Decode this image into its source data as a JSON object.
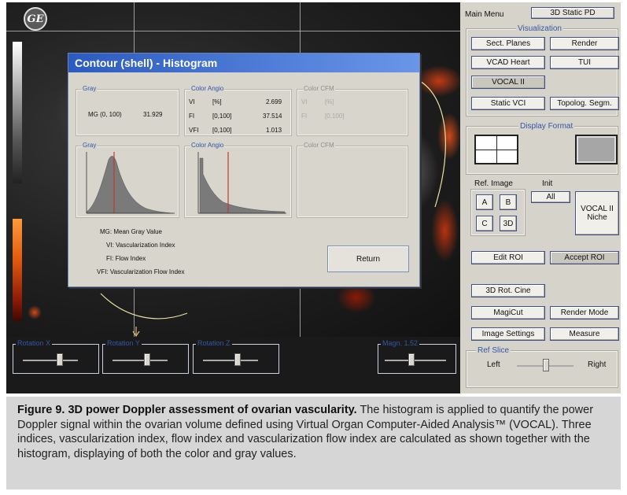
{
  "app": {
    "logo_text": "GE"
  },
  "dialog": {
    "title": "Contour (shell) - Histogram",
    "gray_group": {
      "label": "Gray",
      "mg_label": "MG (0, 100)",
      "mg_value": "31.929"
    },
    "color_angio_group": {
      "label": "Color Angio",
      "rows": [
        {
          "name": "VI",
          "range": "[%]",
          "value": "2.699"
        },
        {
          "name": "FI",
          "range": "[0,100]",
          "value": "37.514"
        },
        {
          "name": "VFI",
          "range": "[0,100]",
          "value": "1.013"
        }
      ]
    },
    "color_cfm_group": {
      "label": "Color CFM",
      "rows": [
        {
          "name": "VI",
          "range": "[%]"
        },
        {
          "name": "FI",
          "range": "[0,100]"
        }
      ]
    },
    "hist_gray_label": "Gray",
    "hist_angio_label": "Color Angio",
    "hist_cfm_label": "Color CFM",
    "legend": [
      {
        "abbr": "MG",
        "text": "Mean Gray Value"
      },
      {
        "abbr": "VI",
        "text": "Vascularization Index"
      },
      {
        "abbr": "FI",
        "text": "Flow Index"
      },
      {
        "abbr": "VFI",
        "text": "Vascularization Flow Index"
      }
    ],
    "return_label": "Return"
  },
  "panel": {
    "main_menu": "Main Menu",
    "mode": "3D Static PD",
    "visualization": "Visualization",
    "buttons": {
      "sect_planes": "Sect. Planes",
      "render": "Render",
      "vcad_heart": "VCAD Heart",
      "tui": "TUI",
      "vocal2": "VOCAL II",
      "static_vci": "Static VCI",
      "topolog": "Topolog. Segm."
    },
    "display_format": "Display Format",
    "ref_image": "Ref. Image",
    "init": "Init",
    "all": "All",
    "planes": [
      "A",
      "B",
      "C",
      "3D"
    ],
    "vocal_niche": "VOCAL II Niche",
    "edit_roi": "Edit ROI",
    "accept_roi": "Accept ROI",
    "rot_cine": "3D Rot. Cine",
    "magicut": "MagiCut",
    "render_mode": "Render Mode",
    "image_settings": "Image Settings",
    "measure": "Measure",
    "ref_slice": "Ref Slice",
    "left": "Left",
    "right": "Right"
  },
  "sliders": {
    "rot_x": "Rotation X",
    "rot_y": "Rotation Y",
    "rot_z": "Rotation Z",
    "magn": "Magn. 1.52"
  },
  "caption": {
    "bold": "Figure 9. 3D power Doppler assessment of ovarian vascularity.",
    "text": " The histogram is applied to quantify the power Doppler signal within the ovarian volume defined using Virtual Organ Computer-Aided Analysis™ (VOCAL). Three indices, vascularization index, flow index and vascularization flow index are calculated as shown together with the histogram, displaying of both the color and gray values."
  },
  "colors": {
    "title_bar": "#2c5bc0",
    "panel_bg": "#d6d3ca",
    "dialog_bg": "#d8d5cc",
    "accent_label": "#3456a8",
    "hist_marker": "#c0392b"
  }
}
